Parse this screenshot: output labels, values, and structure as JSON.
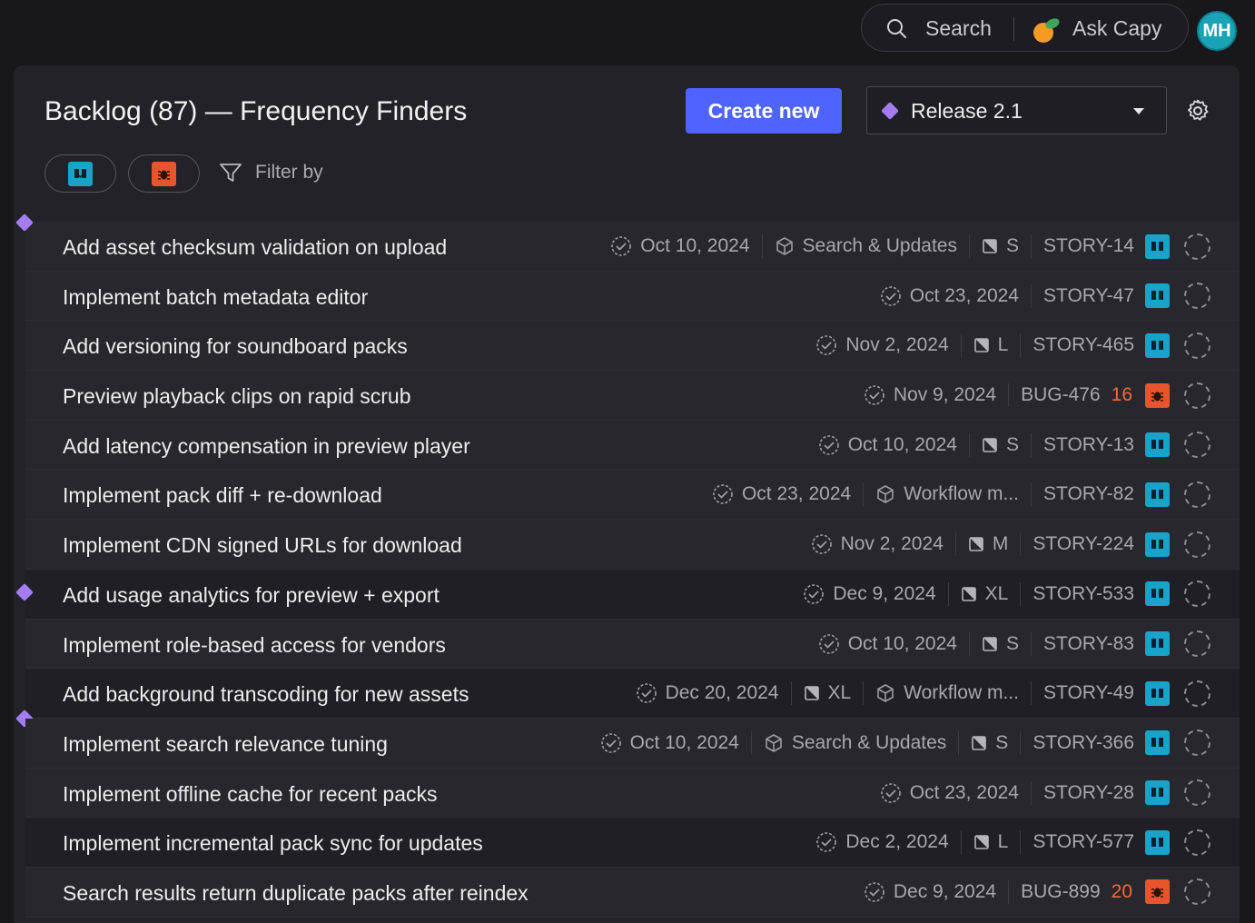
{
  "topbar": {
    "search_label": "Search",
    "ask_label": "Ask Capy",
    "avatar_initials": "MH"
  },
  "header": {
    "title": "Backlog (87) — Frequency Finders",
    "create_label": "Create new",
    "release_label": "Release 2.1",
    "filter_label": "Filter by"
  },
  "colors": {
    "accent": "#4f63ff",
    "story": "#1aa3c8",
    "bug": "#e8552c",
    "release": "#a47cf2"
  },
  "rows": [
    {
      "title": "Add asset checksum validation on upload",
      "date": "Oct 10, 2024",
      "epic": "Search & Updates",
      "size": "S",
      "key": "STORY-14",
      "type": "story"
    },
    {
      "title": "Implement batch metadata editor",
      "date": "Oct 23, 2024",
      "key": "STORY-47",
      "type": "story"
    },
    {
      "title": "Add versioning for soundboard packs",
      "date": "Nov 2, 2024",
      "size": "L",
      "key": "STORY-465",
      "type": "story"
    },
    {
      "title": "Preview playback clips on rapid scrub",
      "date": "Nov 9, 2024",
      "key": "BUG-476",
      "points": "16",
      "type": "bug"
    },
    {
      "title": "Add latency compensation in preview player",
      "date": "Oct 10, 2024",
      "size": "S",
      "key": "STORY-13",
      "type": "story"
    },
    {
      "title": "Implement pack diff + re-download",
      "date": "Oct 23, 2024",
      "epic": "Workflow m...",
      "key": "STORY-82",
      "type": "story"
    },
    {
      "title": "Implement CDN signed URLs for download",
      "date": "Nov 2, 2024",
      "size": "M",
      "key": "STORY-224",
      "type": "story"
    },
    {
      "title": "Add usage analytics for preview + export",
      "date": "Dec 9, 2024",
      "size": "XL",
      "key": "STORY-533",
      "type": "story"
    },
    {
      "title": "Implement role-based access for vendors",
      "date": "Oct 10, 2024",
      "size": "S",
      "key": "STORY-83",
      "type": "story"
    },
    {
      "title": "Add background transcoding for new assets",
      "date": "Dec 20, 2024",
      "size": "XL",
      "epic": "Workflow m...",
      "key": "STORY-49",
      "type": "story"
    },
    {
      "title": "Implement search relevance tuning",
      "date": "Oct 10, 2024",
      "epic": "Search & Updates",
      "size": "S",
      "key": "STORY-366",
      "type": "story"
    },
    {
      "title": "Implement offline cache for recent packs",
      "date": "Oct 23, 2024",
      "key": "STORY-28",
      "type": "story"
    },
    {
      "title": "Implement incremental pack sync for updates",
      "date": "Dec 2, 2024",
      "size": "L",
      "key": "STORY-577",
      "type": "story"
    },
    {
      "title": "Search results return duplicate packs after reindex",
      "date": "Dec 9, 2024",
      "key": "BUG-899",
      "points": "20",
      "type": "bug"
    }
  ]
}
